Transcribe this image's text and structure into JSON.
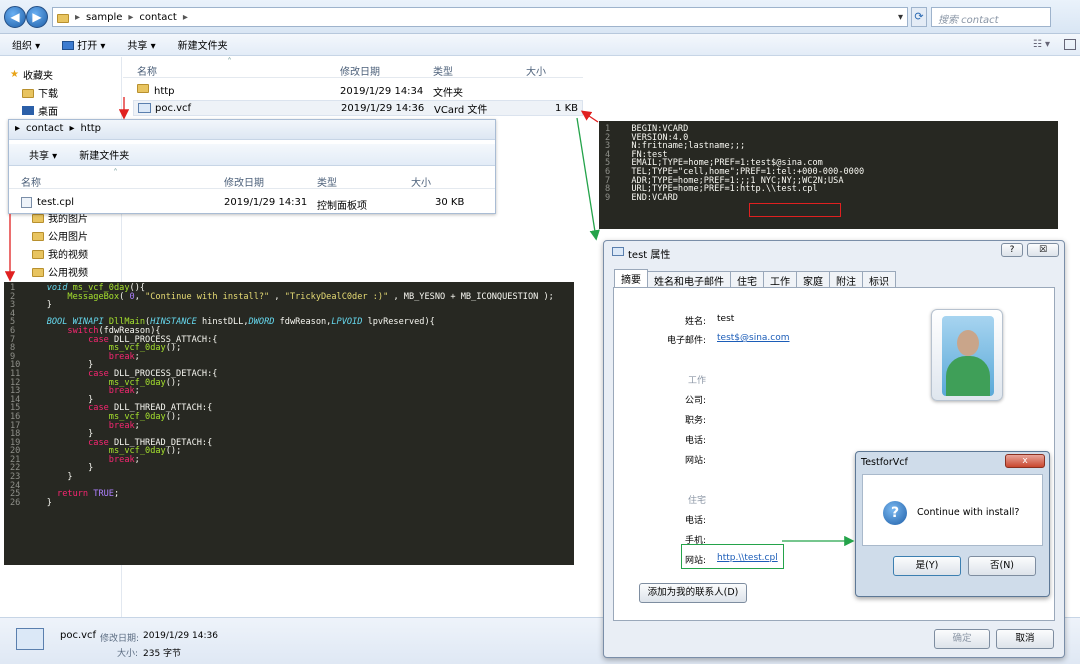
{
  "explorer": {
    "breadcrumb": [
      "sample",
      "contact"
    ],
    "search_placeholder": "搜索 contact",
    "toolbar": [
      "组织 ▾",
      "打开 ▾",
      "共享 ▾",
      "新建文件夹"
    ],
    "sidebar": [
      "收藏夹",
      "下载",
      "桌面",
      "我的图片",
      "公用图片",
      "我的视频",
      "公用视频"
    ],
    "columns": [
      "名称",
      "修改日期",
      "类型",
      "大小"
    ],
    "files": [
      {
        "name": "http",
        "date": "2019/1/29 14:34",
        "type": "文件夹",
        "size": ""
      },
      {
        "name": "poc.vcf",
        "date": "2019/1/29 14:36",
        "type": "VCard 文件",
        "size": "1 KB"
      }
    ],
    "status": {
      "name": "poc.vcf",
      "date_label": "修改日期:",
      "date": "2019/1/29 14:36",
      "size_label": "大小:",
      "size": "235 字节"
    }
  },
  "overlay": {
    "breadcrumb": [
      "contact",
      "http"
    ],
    "toolbar": [
      "共享 ▾",
      "新建文件夹"
    ],
    "columns": [
      "名称",
      "修改日期",
      "类型",
      "大小"
    ],
    "file": {
      "name": "test.cpl",
      "date": "2019/1/29 14:31",
      "type": "控制面板项",
      "size": "30 KB"
    }
  },
  "vcard_code": [
    "BEGIN:VCARD",
    "VERSION:4.0",
    "N:fritname;lastname;;;",
    "FN:test",
    "EMAIL;TYPE=home;PREF=1:test$@sina.com",
    "TEL;TYPE=\"cell,home\";PREF=1:tel:+000-000-0000",
    "ADR;TYPE=home;PREF=1:;;1 NYC;NY;;WC2N;USA",
    "URL;TYPE=home;PREF=1:http.\\\\test.cpl",
    "END:VCARD"
  ],
  "dialog": {
    "title": "test 属性",
    "help": "?",
    "close": "☒",
    "tabs": [
      "摘要",
      "姓名和电子邮件",
      "住宅",
      "工作",
      "家庭",
      "附注",
      "标识"
    ],
    "name_label": "姓名:",
    "name": "test",
    "email_label": "电子邮件:",
    "email": "test$@sina.com",
    "work_header": "工作",
    "work_fields": [
      "公司:",
      "职务:",
      "电话:",
      "网站:"
    ],
    "home_header": "住宅",
    "home_fields": [
      "电话:",
      "手机:"
    ],
    "site_label": "网站:",
    "site": "http.\\\\test.cpl",
    "add_button": "添加为我的联系人(D)",
    "ok": "确定",
    "cancel": "取消"
  },
  "msgbox": {
    "title": "TestforVcf",
    "message": "Continue with install?",
    "yes": "是(Y)",
    "no": "否(N)"
  }
}
